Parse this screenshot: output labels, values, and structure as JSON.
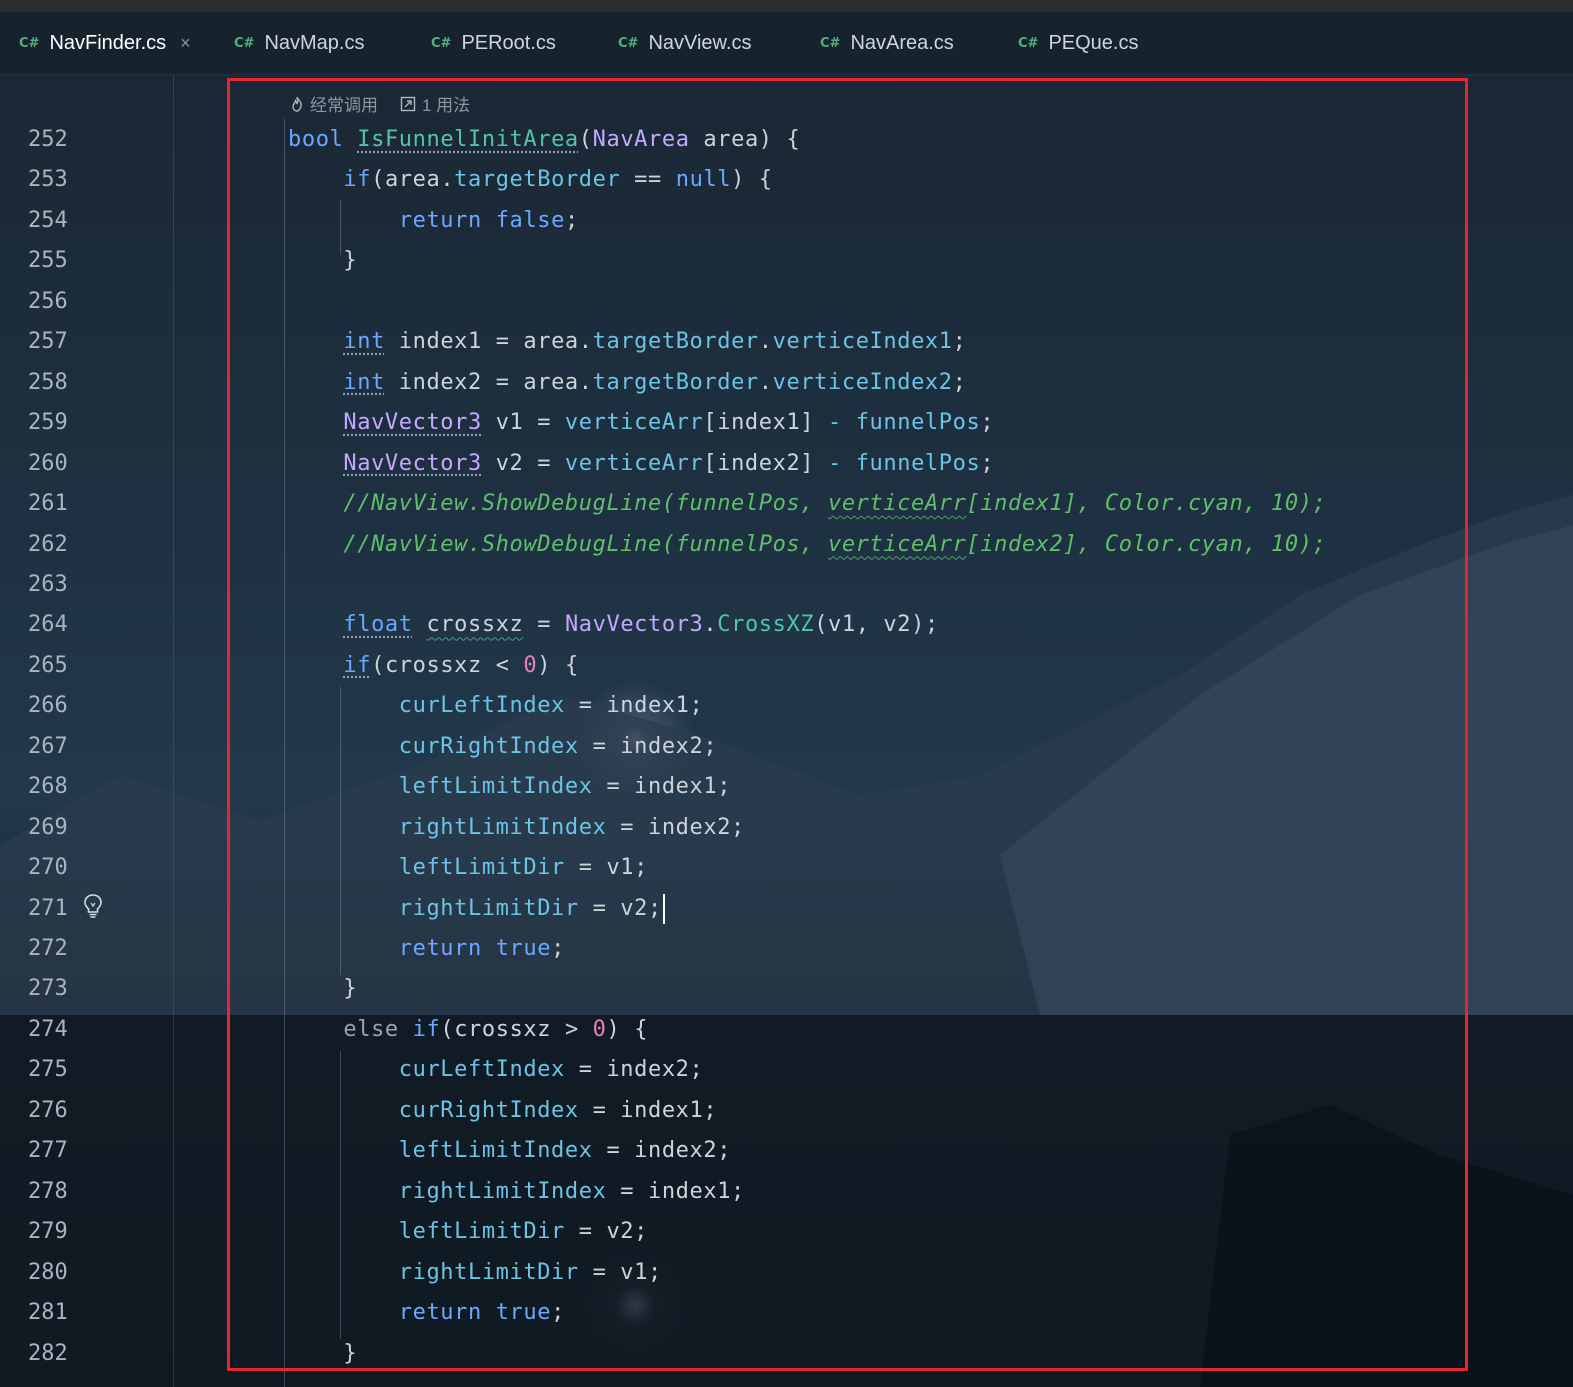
{
  "tabs": [
    {
      "lang": "C#",
      "name": "NavFinder.cs",
      "active": true
    },
    {
      "lang": "C#",
      "name": "NavMap.cs"
    },
    {
      "lang": "C#",
      "name": "PERoot.cs"
    },
    {
      "lang": "C#",
      "name": "NavView.cs"
    },
    {
      "lang": "C#",
      "name": "NavArea.cs"
    },
    {
      "lang": "C#",
      "name": "PEQue.cs"
    }
  ],
  "close_glyph": "×",
  "hints": {
    "frequent": "经常调用",
    "usages": "1 用法"
  },
  "icons": {
    "hint1": "flame-icon",
    "hint2": "usage-link-icon",
    "gutter": "lightbulb-icon"
  },
  "colors": {
    "highlight_border": "#e3262f",
    "tab_underline": "#3574f0"
  },
  "lines": [
    {
      "n": "252",
      "text": "bool IsFunnelInitArea(NavArea area) {"
    },
    {
      "n": "253",
      "text": "    if(area.targetBorder == null) {"
    },
    {
      "n": "254",
      "text": "        return false;"
    },
    {
      "n": "255",
      "text": "    }"
    },
    {
      "n": "256",
      "text": ""
    },
    {
      "n": "257",
      "text": "    int index1 = area.targetBorder.verticeIndex1;"
    },
    {
      "n": "258",
      "text": "    int index2 = area.targetBorder.verticeIndex2;"
    },
    {
      "n": "259",
      "text": "    NavVector3 v1 = verticeArr[index1] - funnelPos;"
    },
    {
      "n": "260",
      "text": "    NavVector3 v2 = verticeArr[index2] - funnelPos;"
    },
    {
      "n": "261",
      "text": "    //NavView.ShowDebugLine(funnelPos, verticeArr[index1], Color.cyan, 10);"
    },
    {
      "n": "262",
      "text": "    //NavView.ShowDebugLine(funnelPos, verticeArr[index2], Color.cyan, 10);"
    },
    {
      "n": "263",
      "text": ""
    },
    {
      "n": "264",
      "text": "    float crossxz = NavVector3.CrossXZ(v1, v2);"
    },
    {
      "n": "265",
      "text": "    if(crossxz < 0) {"
    },
    {
      "n": "266",
      "text": "        curLeftIndex = index1;"
    },
    {
      "n": "267",
      "text": "        curRightIndex = index2;"
    },
    {
      "n": "268",
      "text": "        leftLimitIndex = index1;"
    },
    {
      "n": "269",
      "text": "        rightLimitIndex = index2;"
    },
    {
      "n": "270",
      "text": "        leftLimitDir = v1;"
    },
    {
      "n": "271",
      "text": "        rightLimitDir = v2;"
    },
    {
      "n": "272",
      "text": "        return true;"
    },
    {
      "n": "273",
      "text": "    }"
    },
    {
      "n": "274",
      "text": "    else if(crossxz > 0) {"
    },
    {
      "n": "275",
      "text": "        curLeftIndex = index2;"
    },
    {
      "n": "276",
      "text": "        curRightIndex = index1;"
    },
    {
      "n": "277",
      "text": "        leftLimitIndex = index2;"
    },
    {
      "n": "278",
      "text": "        rightLimitIndex = index1;"
    },
    {
      "n": "279",
      "text": "        leftLimitDir = v2;"
    },
    {
      "n": "280",
      "text": "        rightLimitDir = v1;"
    },
    {
      "n": "281",
      "text": "        return true;"
    },
    {
      "n": "282",
      "text": "    }"
    }
  ]
}
